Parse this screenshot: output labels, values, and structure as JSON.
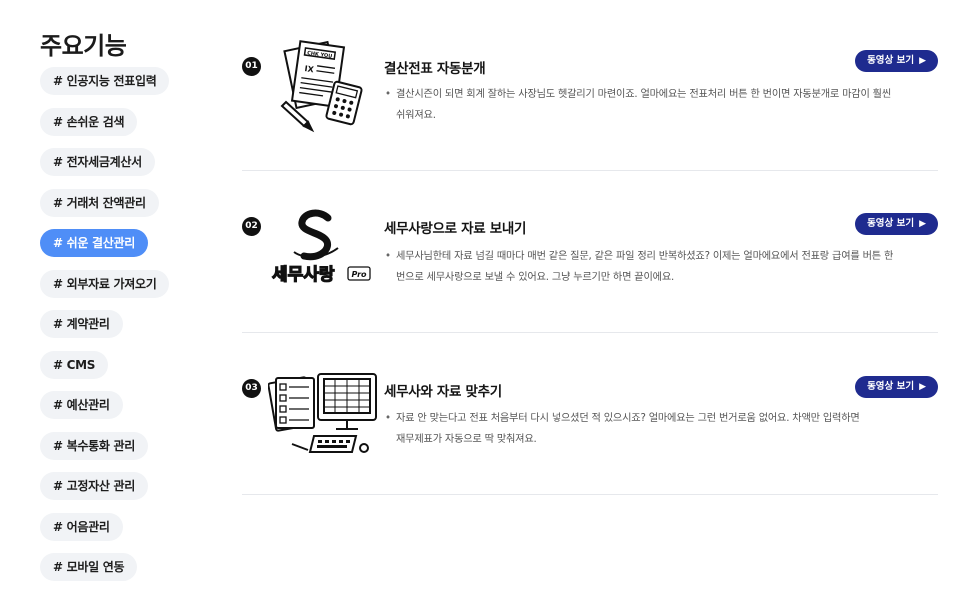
{
  "sidebar": {
    "title": "주요기능",
    "items": [
      {
        "label": "# 인공지능 전표입력",
        "active": false
      },
      {
        "label": "# 손쉬운 검색",
        "active": false
      },
      {
        "label": "# 전자세금계산서",
        "active": false
      },
      {
        "label": "# 거래처 잔액관리",
        "active": false
      },
      {
        "label": "# 쉬운 결산관리",
        "active": true
      },
      {
        "label": "# 외부자료 가져오기",
        "active": false
      },
      {
        "label": "# 계약관리",
        "active": false
      },
      {
        "label": "# CMS",
        "active": false
      },
      {
        "label": "# 예산관리",
        "active": false
      },
      {
        "label": "# 복수통화 관리",
        "active": false
      },
      {
        "label": "# 고정자산 관리",
        "active": false
      },
      {
        "label": "# 어음관리",
        "active": false
      },
      {
        "label": "# 모바일 연동",
        "active": false
      }
    ]
  },
  "features": [
    {
      "num": "01",
      "title": "결산전표 자동분개",
      "button": "동영상 보기",
      "desc_line1": "결산시즌이 되면 회계 잘하는 사장님도 헷갈리기 마련이죠. 얼마에요는 전표처리 버튼 한 번이면 자동분개로 마감이 훨씬",
      "desc_line2": "쉬워져요.",
      "paper_label": "CHK YOU",
      "paper_mark": "IX"
    },
    {
      "num": "02",
      "title": "세무사랑으로 자료 보내기",
      "button": "동영상 보기",
      "desc_line1": "세무사님한테 자료 넘길 때마다 매번 같은 질문, 같은 파일 정리 반복하셨죠? 이제는 얼마에요에서 전표랑 급여를 버튼 한",
      "desc_line2": "번으로 세무사랑으로 보낼 수 있어요. 그냥 누르기만 하면 끝이에요.",
      "logo_text": "세무사랑",
      "logo_suffix": "Pro"
    },
    {
      "num": "03",
      "title": "세무사와 자료 맞추기",
      "button": "동영상 보기",
      "desc_line1": "자료 안 맞는다고 전표 처음부터 다시 넣으셨던 적 있으시죠? 얼마에요는 그런 번거로움 없어요. 차액만 입력하면",
      "desc_line2": "재무제표가 자동으로 딱 맞춰져요."
    }
  ],
  "icons": {
    "bullet": "•",
    "play": "▶"
  },
  "colors": {
    "active_chip": "#4f8ef7",
    "video_button": "#1f2b8f"
  }
}
